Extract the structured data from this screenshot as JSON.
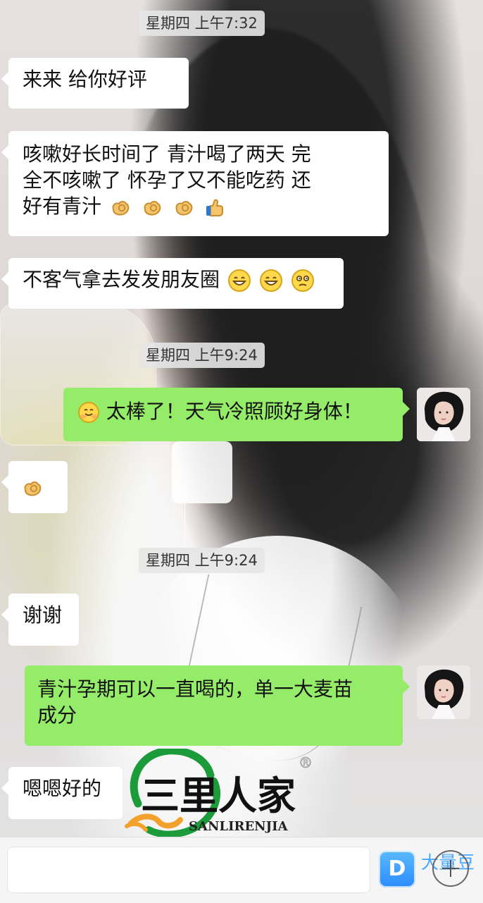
{
  "chat": {
    "timestamps": [
      {
        "text": "星期四 上午7:32"
      },
      {
        "text": "星期四 上午9:24"
      },
      {
        "text": "星期四 上午9:24"
      }
    ],
    "messages": {
      "m1": "来来  给你好评",
      "m2a": "咳嗽好长时间了     青汁喝了两天  完",
      "m2b": "全不咳嗽了    怀孕了又不能吃药    还",
      "m2c": "好有青汁",
      "m3": "不客气拿去发发朋友圈",
      "m4": "太棒了！天气冷照顾好身体！",
      "m6": "谢谢",
      "m7a": "青汁孕期可以一直喝的，单一大麦苗",
      "m7b": "成分",
      "m8": "嗯嗯好的"
    }
  },
  "brand": {
    "chinese_logo_text": "三里人家",
    "latin_logo_text": "SANLIRENJIA",
    "registered": "®"
  },
  "watermark": {
    "badge_letter": "D",
    "label": "大量豆"
  },
  "colors": {
    "green_bubble": "#95ec69",
    "white_bubble": "#ffffff",
    "brand_green": "#1c9b3a",
    "accent_orange": "#f2a12a",
    "watermark_blue": "#2d8cff"
  },
  "icons": {
    "ok_hand": "ok-hand-icon",
    "thumbs_up": "thumbs-up-icon",
    "grin": "grin-face-icon",
    "wink": "wink-face-icon",
    "hug": "hug-face-icon",
    "plus": "plus-icon"
  }
}
